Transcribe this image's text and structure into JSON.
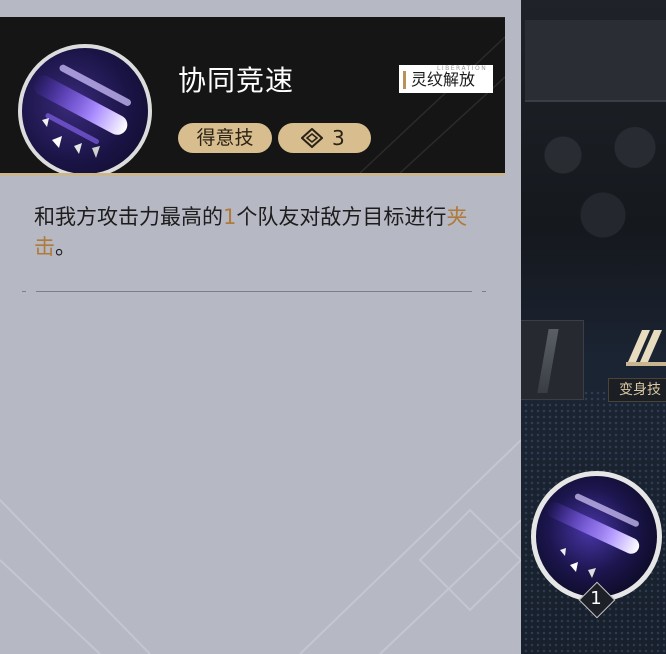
{
  "skill": {
    "name": "协同竞速",
    "type_tag": "得意技",
    "cost": "3",
    "unlock_badge": {
      "small_text": "LIBERATION",
      "label": "灵纹解放"
    },
    "description": {
      "part1": "和我方攻击力最高的",
      "highlight1": "1",
      "part2": "个队友对敌方目标进行",
      "highlight2": "夹击",
      "part3": "。"
    }
  },
  "background": {
    "transform_label": "变身技",
    "skill_count": "1"
  },
  "colors": {
    "panel_bg": "#b6b8c3",
    "header_bg": "#151515",
    "tag_gold": "#d8bd8f",
    "highlight": "#b07a3a"
  }
}
